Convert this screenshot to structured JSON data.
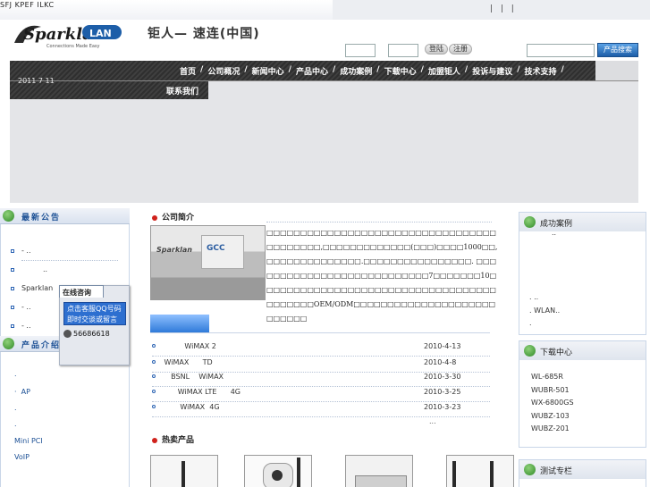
{
  "top": {
    "gibberish": "SFJ KPEF ILKC",
    "bars": "|  |  |"
  },
  "header": {
    "logo_word": "Sparklan",
    "logo_tag": "LAN",
    "logo_sub": "Connections Made Easy",
    "brand_title": "钜人— 速连(中国)",
    "login_label": "登陆",
    "register_label": "注册",
    "search_button": "产品搜索"
  },
  "nav": {
    "date": "2011 7 11",
    "items": [
      "首页",
      "公司概况",
      "新闻中心",
      "产品中心",
      "成功案例",
      "下载中心",
      "加盟钜人",
      "投诉与建议",
      "技术支持"
    ],
    "last_item": "联系我们"
  },
  "left": {
    "news_title": "最新公告",
    "news_items": [
      "-    ..",
      "..",
      "Sparklan",
      "-    ..",
      "-    .."
    ],
    "products_title": "产品介绍",
    "product_items": [
      ".",
      "AP",
      ".",
      ".",
      "Mini PCI",
      "VoIP"
    ]
  },
  "chat": {
    "tab": "在线咨询",
    "qq_line1": "点击客服QQ号码",
    "qq_line2": "即时交谈或留言",
    "phone": "56686618"
  },
  "center": {
    "intro_title": "公司简介",
    "photo_sign": "GCC",
    "photo_brand": "Sparklan",
    "intro_text": "□□□□□□□□□□□□□□□□□□□□□□□□□□□□□□□□□□□□□□□□□□,□□□□□□□□□□□□□(□□□)□□□□1000□□,□□□□□□□□□□□□□□.□□□□□□□□□□□□□□□□. □□□□□□□□□□□□□□□□□□□□□□□□□□□7□□□□□□□10□□□□□□□□□□□□□□□□□□□□□□□□□□□□□□□□□□□□□□□□□□OEM/ODM□□□□□□□□□□□□□□□□□□□□□□□□□□□",
    "news": [
      {
        "title": "          WiMAX 2",
        "date": "2010-4-13"
      },
      {
        "title": " WiMAX      TD",
        "date": "2010-4-8"
      },
      {
        "title": "    BSNL    WiMAX",
        "date": "2010-3-30"
      },
      {
        "title": "       WiMAX LTE      4G",
        "date": "2010-3-25"
      },
      {
        "title": "        WiMAX  4G",
        "date": "2010-3-23"
      }
    ],
    "more": "...",
    "hot_title": "热卖产品"
  },
  "right": {
    "cases_title": "成功案例",
    "cases_items": [
      "..",
      ".      ..",
      ".        WLAN..",
      "."
    ],
    "downloads_title": "下载中心",
    "downloads_items": [
      "WL-685R",
      "WUBR-501",
      "WX-6800GS",
      "WUBZ-103",
      "WUBZ-201"
    ],
    "test_title": "测试专栏"
  }
}
